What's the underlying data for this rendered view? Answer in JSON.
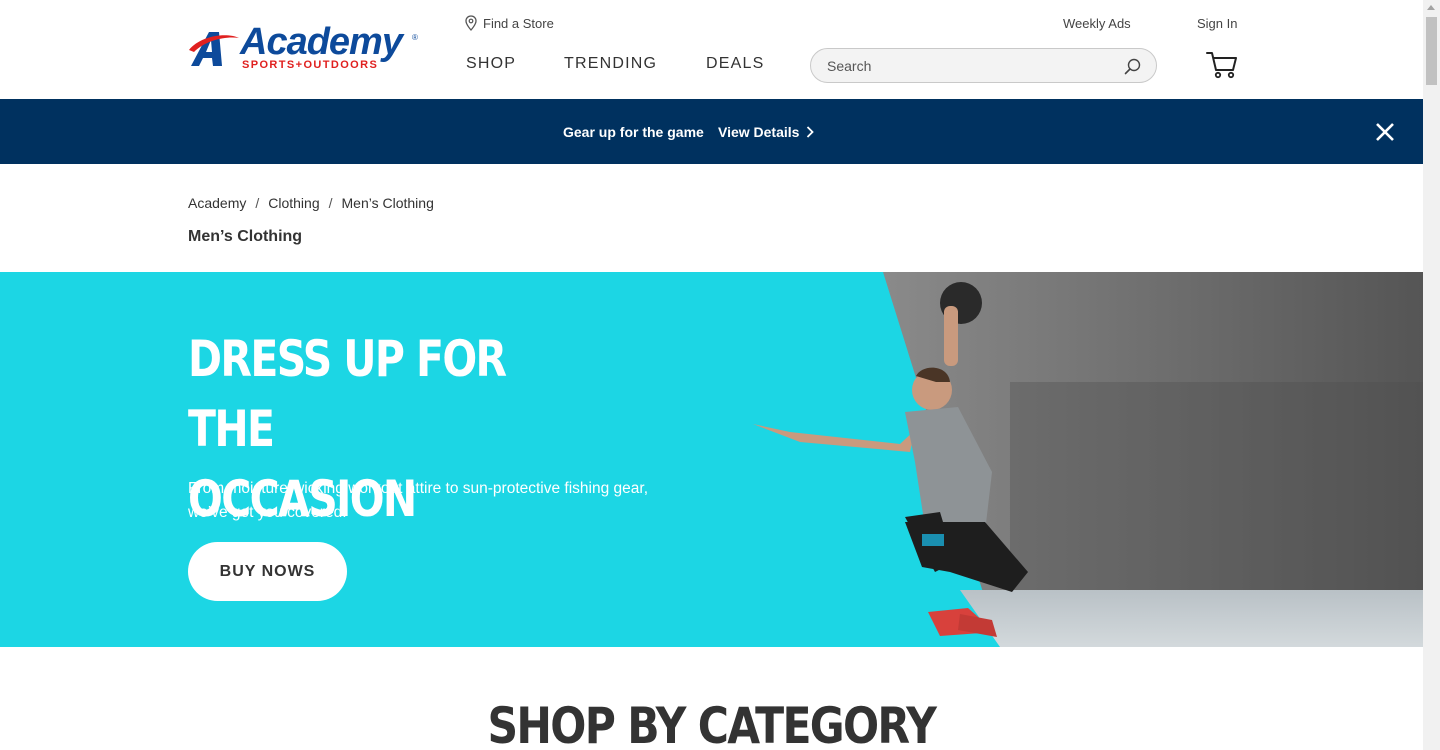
{
  "header": {
    "logo_word": "Academy",
    "logo_tagline": "SPORTS+OUTDOORS",
    "logo_reg": "®",
    "find_store": "Find a Store",
    "weekly_ads": "Weekly Ads",
    "sign_in": "Sign In",
    "nav": [
      {
        "label": "SHOP"
      },
      {
        "label": "TRENDING"
      },
      {
        "label": "DEALS"
      }
    ],
    "search_placeholder": "Search"
  },
  "promo": {
    "text": "Gear up for the game",
    "link": "View Details"
  },
  "breadcrumb": [
    {
      "label": "Academy"
    },
    {
      "label": "Clothing"
    },
    {
      "label": "Men’s Clothing"
    }
  ],
  "page_title": "Men’s Clothing",
  "hero": {
    "title_line1": "DRESS UP FOR THE",
    "title_line2": "OCCASION",
    "subtitle": "From moisture-wicking workout attire to sun-protective fishing gear, we’ve got you covered.",
    "button": "BUY NOWS"
  },
  "section_title": "SHOP BY CATEGORY",
  "colors": {
    "brand_blue": "#0d4a9b",
    "brand_red": "#e0201f",
    "promo_bg": "#00315f",
    "hero_bg": "#1cd6e4"
  }
}
